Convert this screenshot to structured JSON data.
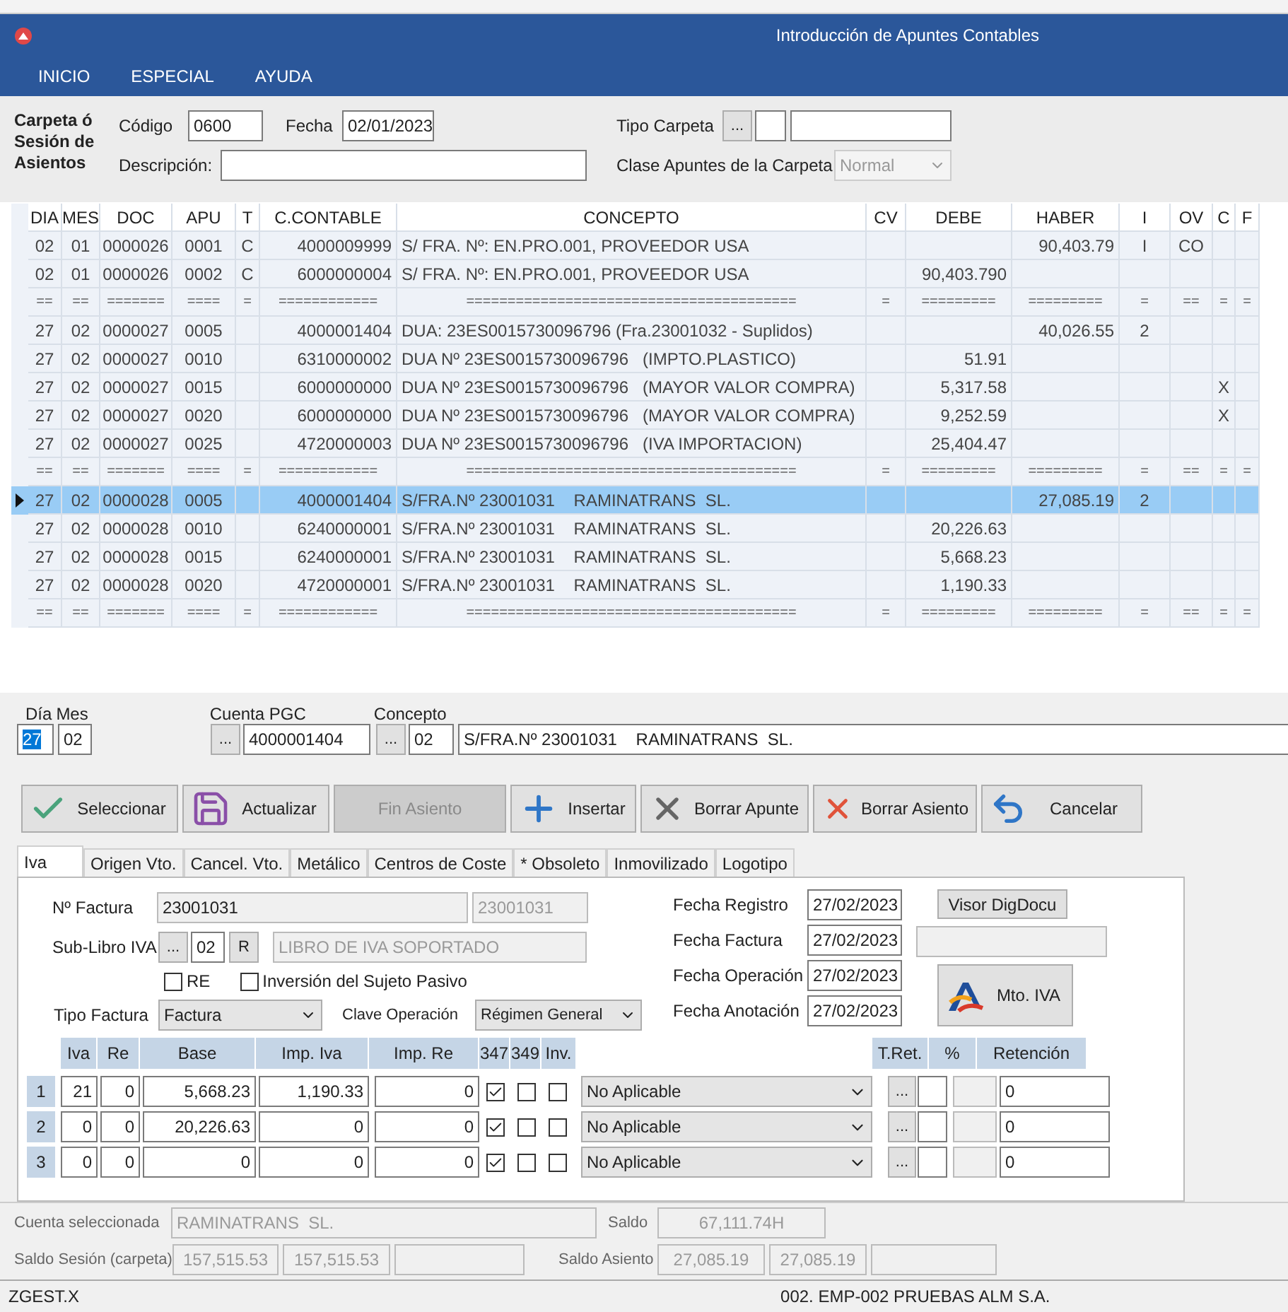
{
  "window": {
    "title": "Introducción de Apuntes Contables"
  },
  "menu": [
    {
      "label": "INICIO"
    },
    {
      "label": "ESPECIAL"
    },
    {
      "label": "AYUDA"
    }
  ],
  "carpeta": {
    "heading": "Carpeta ó Sesión de Asientos",
    "codigo_label": "Código",
    "codigo": "0600",
    "fecha_label": "Fecha",
    "fecha": "02/01/2023",
    "descripcion_label": "Descripción:",
    "tipo_label": "Tipo Carpeta",
    "tipo_button": "...",
    "clase_label": "Clase Apuntes de la Carpeta",
    "clase": "Normal",
    "clase_disabled": true
  },
  "grid": {
    "columns": [
      "DIA",
      "MES",
      "DOC",
      "APU",
      "T",
      "C.CONTABLE",
      "CONCEPTO",
      "CV",
      "DEBE",
      "HABER",
      "I",
      "OV",
      "C",
      "F"
    ],
    "rows": [
      {
        "kind": "entry",
        "selected": false,
        "cells": {
          "dia": "02",
          "mes": "01",
          "doc": "0000026",
          "apu": "0001",
          "t": "C",
          "cuenta": "4000009999",
          "concepto": "S/ FRA. Nº: EN.PRO.001, PROVEEDOR USA",
          "haber": "90,403.79",
          "i": "I",
          "ov": "CO"
        }
      },
      {
        "kind": "entry",
        "selected": false,
        "cells": {
          "dia": "02",
          "mes": "01",
          "doc": "0000026",
          "apu": "0002",
          "t": "C",
          "cuenta": "6000000004",
          "concepto": "S/ FRA. Nº: EN.PRO.001, PROVEEDOR USA",
          "debe": "90,403.790"
        }
      },
      {
        "kind": "separator",
        "selected": false,
        "cells": {
          "dia": "==",
          "mes": "==",
          "doc": "=======",
          "apu": "====",
          "t": "=",
          "cuenta": "============",
          "concepto": "========================================",
          "cv": "=",
          "debe": "=========",
          "haber": "=========",
          "i": "=",
          "ov": "==",
          "c": "=",
          "f": "="
        }
      },
      {
        "kind": "entry",
        "selected": false,
        "cells": {
          "dia": "27",
          "mes": "02",
          "doc": "0000027",
          "apu": "0005",
          "cuenta": "4000001404",
          "concepto": "DUA: 23ES0015730096796 (Fra.23001032 - Suplidos)",
          "haber": "40,026.55",
          "i": "2"
        }
      },
      {
        "kind": "entry",
        "selected": false,
        "cells": {
          "dia": "27",
          "mes": "02",
          "doc": "0000027",
          "apu": "0010",
          "cuenta": "6310000002",
          "concepto": "DUA Nº 23ES0015730096796   (IMPTO.PLASTICO)",
          "debe": "51.91"
        }
      },
      {
        "kind": "entry",
        "selected": false,
        "cells": {
          "dia": "27",
          "mes": "02",
          "doc": "0000027",
          "apu": "0015",
          "cuenta": "6000000000",
          "concepto": "DUA Nº 23ES0015730096796   (MAYOR VALOR COMPRA)",
          "debe": "5,317.58",
          "c": "X"
        }
      },
      {
        "kind": "entry",
        "selected": false,
        "cells": {
          "dia": "27",
          "mes": "02",
          "doc": "0000027",
          "apu": "0020",
          "cuenta": "6000000000",
          "concepto": "DUA Nº 23ES0015730096796   (MAYOR VALOR COMPRA)",
          "debe": "9,252.59",
          "c": "X"
        }
      },
      {
        "kind": "entry",
        "selected": false,
        "cells": {
          "dia": "27",
          "mes": "02",
          "doc": "0000027",
          "apu": "0025",
          "cuenta": "4720000003",
          "concepto": "DUA Nº 23ES0015730096796   (IVA IMPORTACION)",
          "debe": "25,404.47"
        }
      },
      {
        "kind": "separator",
        "selected": false,
        "cells": {
          "dia": "==",
          "mes": "==",
          "doc": "=======",
          "apu": "====",
          "t": "=",
          "cuenta": "============",
          "concepto": "========================================",
          "cv": "=",
          "debe": "=========",
          "haber": "=========",
          "i": "=",
          "ov": "==",
          "c": "=",
          "f": "="
        }
      },
      {
        "kind": "entry",
        "selected": true,
        "cells": {
          "dia": "27",
          "mes": "02",
          "doc": "0000028",
          "apu": "0005",
          "cuenta": "4000001404",
          "concepto": "S/FRA.Nº 23001031    RAMINATRANS  SL.",
          "haber": "27,085.19",
          "i": "2"
        }
      },
      {
        "kind": "entry",
        "selected": false,
        "cells": {
          "dia": "27",
          "mes": "02",
          "doc": "0000028",
          "apu": "0010",
          "cuenta": "6240000001",
          "concepto": "S/FRA.Nº 23001031    RAMINATRANS  SL.",
          "debe": "20,226.63"
        }
      },
      {
        "kind": "entry",
        "selected": false,
        "cells": {
          "dia": "27",
          "mes": "02",
          "doc": "0000028",
          "apu": "0015",
          "cuenta": "6240000001",
          "concepto": "S/FRA.Nº 23001031    RAMINATRANS  SL.",
          "debe": "5,668.23"
        }
      },
      {
        "kind": "entry",
        "selected": false,
        "cells": {
          "dia": "27",
          "mes": "02",
          "doc": "0000028",
          "apu": "0020",
          "cuenta": "4720000001",
          "concepto": "S/FRA.Nº 23001031    RAMINATRANS  SL.",
          "debe": "1,190.33"
        }
      },
      {
        "kind": "separator",
        "selected": false,
        "cells": {
          "dia": "==",
          "mes": "==",
          "doc": "=======",
          "apu": "====",
          "t": "=",
          "cuenta": "============",
          "concepto": "========================================",
          "cv": "=",
          "debe": "=========",
          "haber": "=========",
          "i": "=",
          "ov": "==",
          "c": "=",
          "f": "="
        }
      }
    ]
  },
  "entry": {
    "dia_label": "Día",
    "dia": "27",
    "mes_label": "Mes",
    "mes": "02",
    "cuenta_label": "Cuenta PGC",
    "cuenta_button": "...",
    "cuenta": "4000001404",
    "concepto_label": "Concepto",
    "concepto_button": "...",
    "concepto_code": "02",
    "concepto": "S/FRA.Nº 23001031    RAMINATRANS  SL."
  },
  "buttons": [
    {
      "label": "Seleccionar",
      "disabled": false
    },
    {
      "label": "Actualizar",
      "disabled": false
    },
    {
      "label": "Fin Asiento",
      "disabled": true
    },
    {
      "label": "Insertar",
      "disabled": false
    },
    {
      "label": "Borrar Apunte",
      "disabled": false
    },
    {
      "label": "Borrar Asiento",
      "disabled": false
    },
    {
      "label": "Cancelar",
      "disabled": false
    }
  ],
  "tabs": [
    {
      "label": "Iva",
      "selected": true
    },
    {
      "label": "Origen Vto.",
      "selected": false
    },
    {
      "label": "Cancel. Vto.",
      "selected": false
    },
    {
      "label": "Metálico",
      "selected": false
    },
    {
      "label": "Centros de Coste",
      "selected": false
    },
    {
      "label": "* Obsoleto",
      "selected": false
    },
    {
      "label": "Inmovilizado",
      "selected": false
    },
    {
      "label": "Logotipo",
      "selected": false
    }
  ],
  "iva": {
    "factura_label": "Nº Factura",
    "factura": "23001031",
    "factura_copy": "23001031",
    "sublibro_label": "Sub-Libro IVA",
    "sublibro_button": "...",
    "sublibro": "02",
    "sublibro_r": "R",
    "sublibro_name": "LIBRO DE IVA SOPORTADO",
    "re_label": "RE",
    "re_checked": false,
    "inversion_label": "Inversión del Sujeto Pasivo",
    "inversion_checked": false,
    "tipo_label": "Tipo Factura",
    "tipo": "Factura",
    "clave_label": "Clave Operación",
    "clave": "Régimen General",
    "dates": [
      {
        "label": "Fecha Registro",
        "value": "27/02/2023"
      },
      {
        "label": "Fecha Factura",
        "value": "27/02/2023"
      },
      {
        "label": "Fecha Operación",
        "value": "27/02/2023"
      },
      {
        "label": "Fecha Anotación",
        "value": "27/02/2023"
      }
    ],
    "visor_button": "Visor DigDocu",
    "mto_button": "Mto. IVA",
    "columns": [
      "Iva",
      "Re",
      "Base",
      "Imp. Iva",
      "Imp. Re",
      "347",
      "349",
      "Inv.",
      "T.Ret.",
      "%",
      "Retención"
    ],
    "rows": [
      {
        "number": "1",
        "iva": "21",
        "re": "0",
        "base": "5,668.23",
        "imp_iva": "1,190.33",
        "imp_re": "0",
        "c347": true,
        "c349": false,
        "inv": false,
        "retencion_tipo": "No Aplicable",
        "tret_button": "...",
        "retencion": "0"
      },
      {
        "number": "2",
        "iva": "0",
        "re": "0",
        "base": "20,226.63",
        "imp_iva": "0",
        "imp_re": "0",
        "c347": true,
        "c349": false,
        "inv": false,
        "retencion_tipo": "No Aplicable",
        "tret_button": "...",
        "retencion": "0"
      },
      {
        "number": "3",
        "iva": "0",
        "re": "0",
        "base": "0",
        "imp_iva": "0",
        "imp_re": "0",
        "c347": true,
        "c349": false,
        "inv": false,
        "retencion_tipo": "No Aplicable",
        "tret_button": "...",
        "retencion": "0"
      }
    ]
  },
  "totals": {
    "cuenta_label": "Cuenta seleccionada",
    "cuenta": "RAMINATRANS  SL.",
    "saldo_label": "Saldo",
    "saldo": "67,111.74H",
    "sesion_label": "Saldo Sesión (carpeta)",
    "sesion_debe": "157,515.53",
    "sesion_haber": "157,515.53",
    "asiento_label": "Saldo Asiento",
    "asiento_debe": "27,085.19",
    "asiento_haber": "27,085.19"
  },
  "status_bar": {
    "program": "ZGEST.X",
    "company": "002. EMP-002 PRUEBAS ALM S.A."
  }
}
